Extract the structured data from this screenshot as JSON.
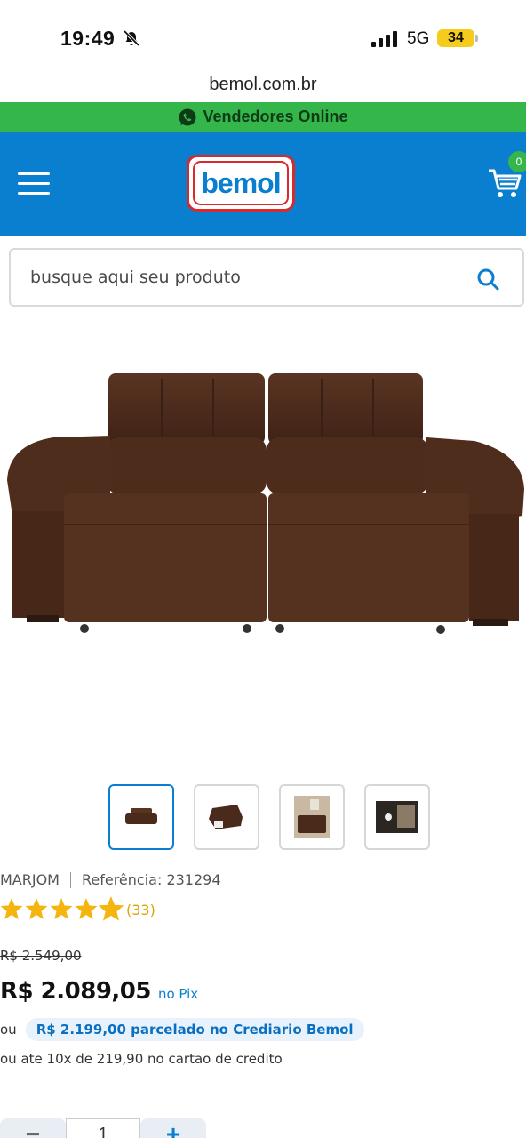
{
  "status": {
    "time": "19:49",
    "network": "5G",
    "battery": "34"
  },
  "browser": {
    "url": "bemol.com.br"
  },
  "vendedores": {
    "label": "Vendedores Online"
  },
  "header": {
    "logo_text": "bemol",
    "cart_count": "0"
  },
  "search": {
    "placeholder": "busque aqui seu produto"
  },
  "product": {
    "brand": "MARJOM",
    "reference": "Referência: 231294",
    "rating": 4.5,
    "rating_count": "(33)",
    "old_price": "R$ 2.549,00",
    "price": "R$ 2.089,05",
    "price_suffix": "no Pix",
    "crediario_prefix": "ou",
    "crediario": "R$ 2.199,00 parcelado no Crediario Bemol",
    "cartao": "ou ate 10x de 219,90 no cartao de credito",
    "quantity": "1",
    "minus_label": "−",
    "plus_label": "+"
  },
  "colors": {
    "brand_blue": "#0a7fd0",
    "whatsapp_green": "#34b64b",
    "sofa_brown": "#4a2a1a",
    "star": "#f5b50f"
  }
}
